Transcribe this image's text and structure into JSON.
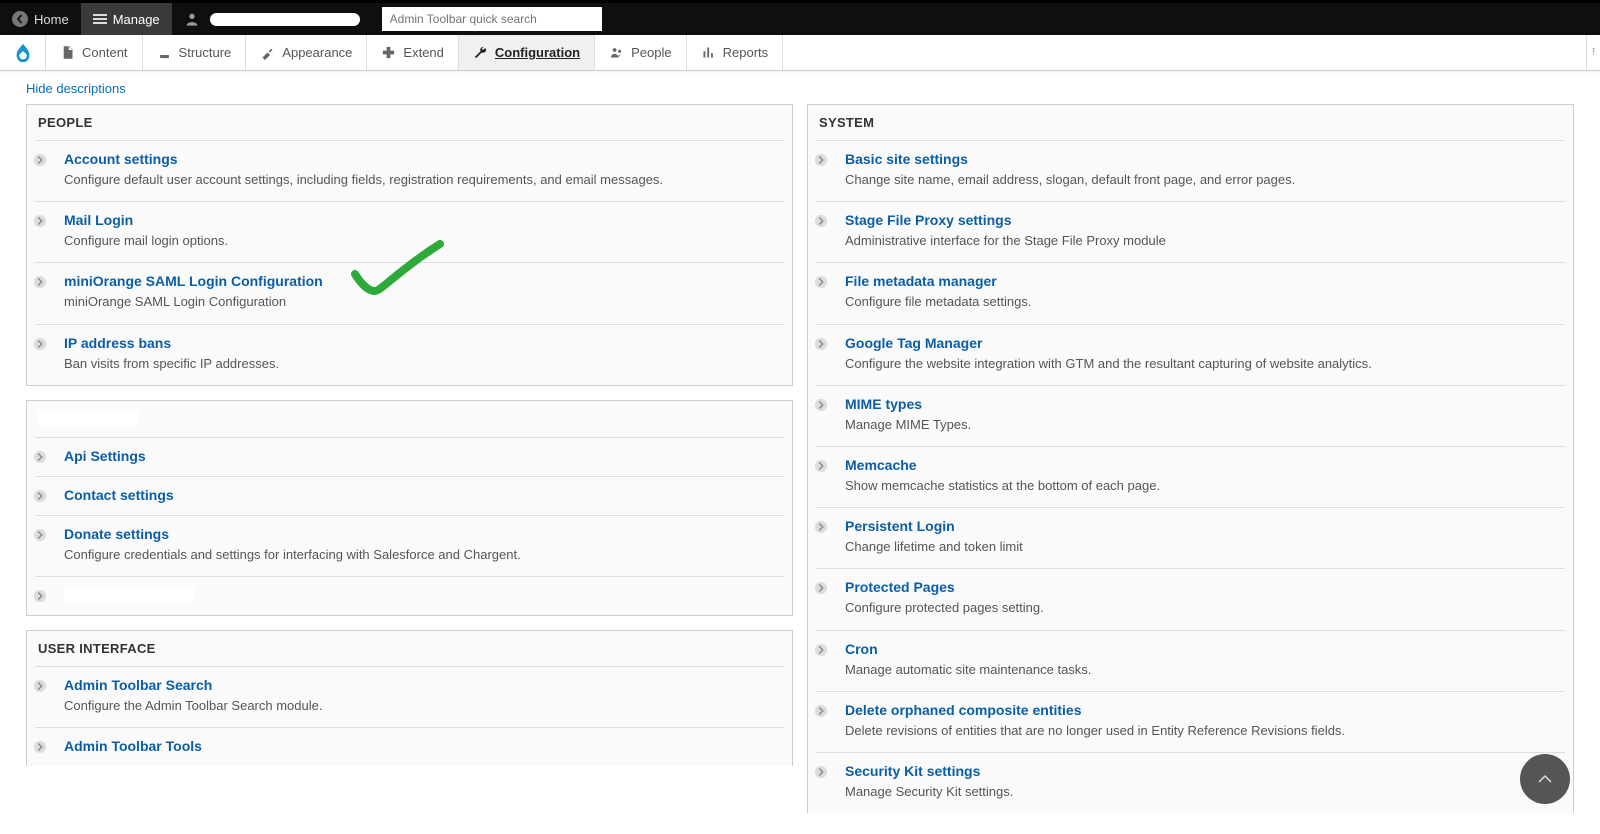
{
  "toolbar": {
    "home": "Home",
    "manage": "Manage",
    "search_placeholder": "Admin Toolbar quick search"
  },
  "adminMenu": {
    "content": "Content",
    "structure": "Structure",
    "appearance": "Appearance",
    "extend": "Extend",
    "configuration": "Configuration",
    "people": "People",
    "reports": "Reports"
  },
  "hideDescriptions": "Hide descriptions",
  "left": {
    "people": {
      "header": "PEOPLE",
      "items": [
        {
          "title": "Account settings",
          "desc": "Configure default user account settings, including fields, registration requirements, and email messages."
        },
        {
          "title": "Mail Login",
          "desc": "Configure mail login options."
        },
        {
          "title": "miniOrange SAML Login Configuration",
          "desc": "miniOrange SAML Login Configuration"
        },
        {
          "title": "IP address bans",
          "desc": "Ban visits from specific IP addresses."
        }
      ]
    },
    "custom": {
      "items": [
        {
          "title": "Api Settings",
          "desc": ""
        },
        {
          "title": "Contact settings",
          "desc": ""
        },
        {
          "title": "Donate settings",
          "desc": "Configure credentials and settings for interfacing with Salesforce and Chargent."
        }
      ]
    },
    "ui": {
      "header": "USER INTERFACE",
      "items": [
        {
          "title": "Admin Toolbar Search",
          "desc": "Configure the Admin Toolbar Search module."
        },
        {
          "title": "Admin Toolbar Tools",
          "desc": ""
        }
      ]
    }
  },
  "right": {
    "system": {
      "header": "SYSTEM",
      "items": [
        {
          "title": "Basic site settings",
          "desc": "Change site name, email address, slogan, default front page, and error pages."
        },
        {
          "title": "Stage File Proxy settings",
          "desc": "Administrative interface for the Stage File Proxy module"
        },
        {
          "title": "File metadata manager",
          "desc": "Configure file metadata settings."
        },
        {
          "title": "Google Tag Manager",
          "desc": "Configure the website integration with GTM and the resultant capturing of website analytics."
        },
        {
          "title": "MIME types",
          "desc": "Manage MIME Types."
        },
        {
          "title": "Memcache",
          "desc": "Show memcache statistics at the bottom of each page."
        },
        {
          "title": "Persistent Login",
          "desc": "Change lifetime and token limit"
        },
        {
          "title": "Protected Pages",
          "desc": "Configure protected pages setting."
        },
        {
          "title": "Cron",
          "desc": "Manage automatic site maintenance tasks."
        },
        {
          "title": "Delete orphaned composite entities",
          "desc": "Delete revisions of entities that are no longer used in Entity Reference Revisions fields."
        },
        {
          "title": "Security Kit settings",
          "desc": "Manage Security Kit settings."
        }
      ]
    }
  }
}
